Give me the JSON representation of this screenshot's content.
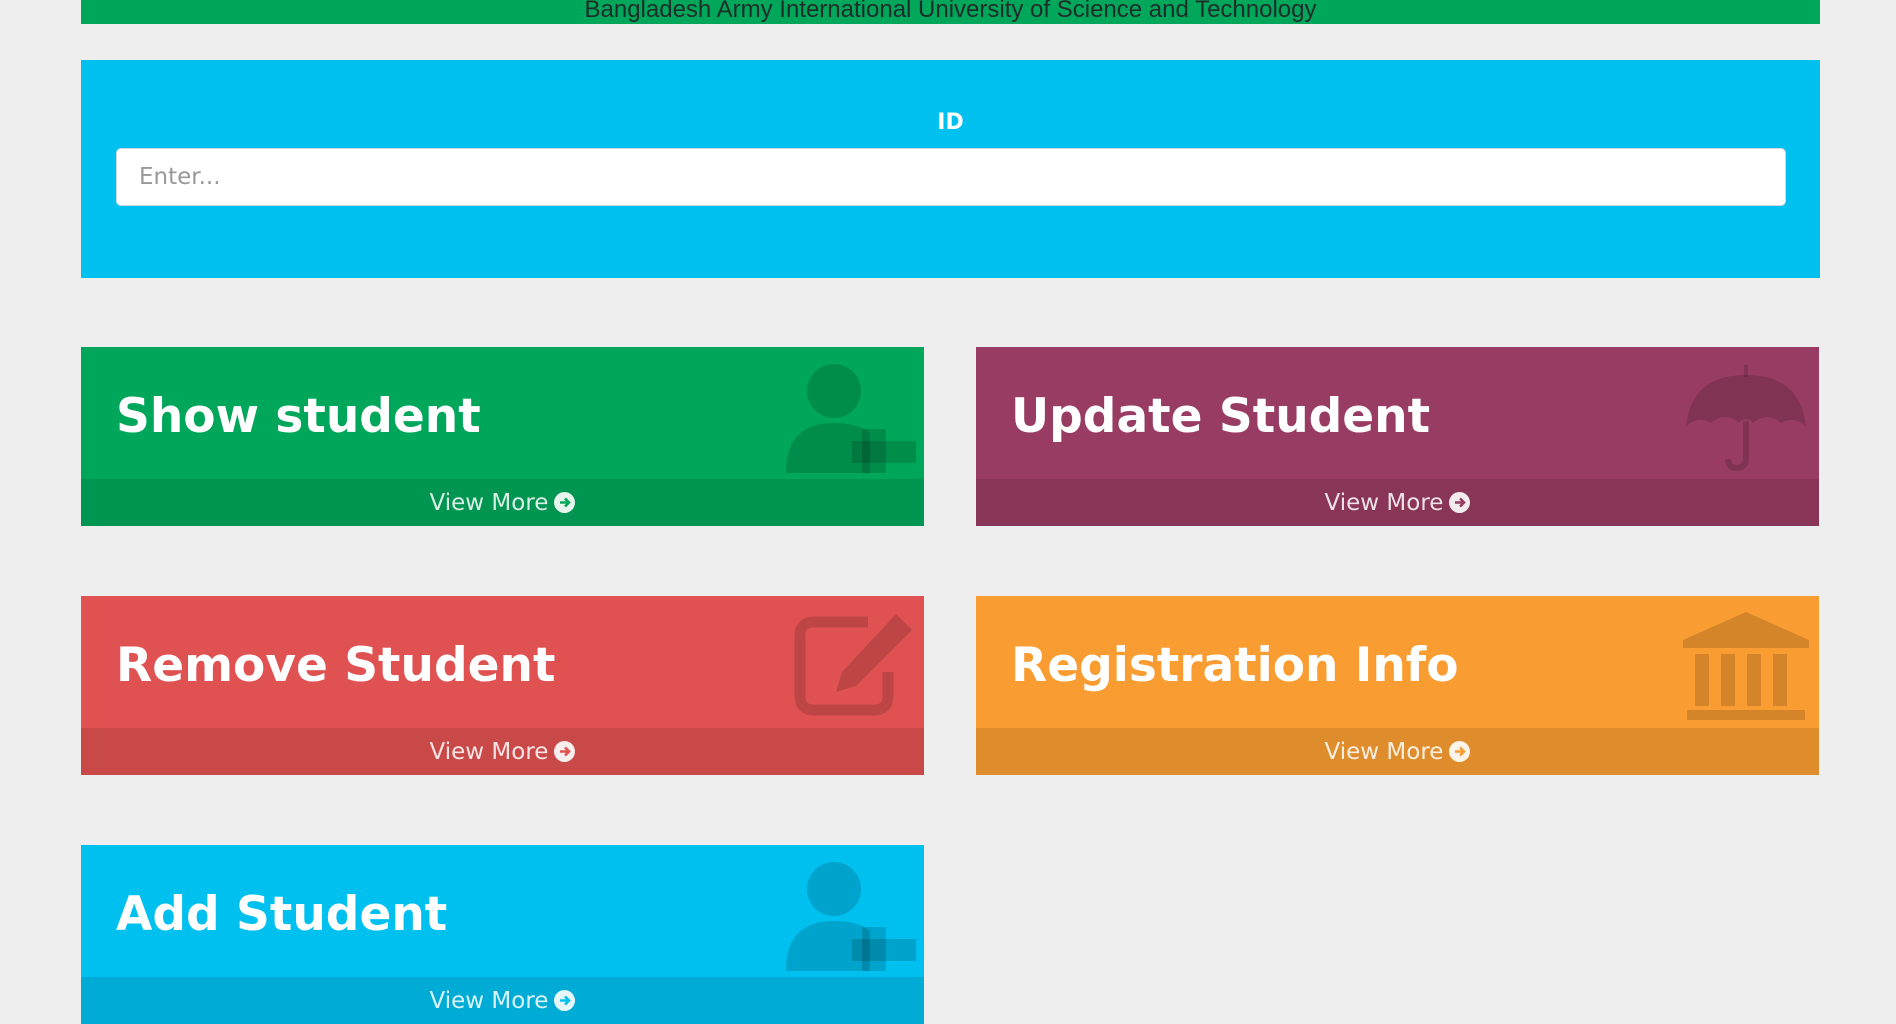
{
  "header": {
    "university_name": "Bangladesh Army International University of Science and Technology"
  },
  "search": {
    "label": "ID",
    "placeholder": "Enter..."
  },
  "boxes": [
    {
      "title": "Show student",
      "link": "View More",
      "color": "#00a65a",
      "icon": "user-plus-icon"
    },
    {
      "title": "Update Student",
      "link": "View More",
      "color": "#983c63",
      "icon": "umbrella-icon"
    },
    {
      "title": "Remove Student",
      "link": "View More",
      "color": "#e05252",
      "icon": "edit-icon"
    },
    {
      "title": "Registration Info",
      "link": "View More",
      "color": "#f99d32",
      "icon": "bank-icon"
    },
    {
      "title": "Add Student",
      "link": "View More",
      "color": "#00c0ef",
      "icon": "user-plus-icon"
    }
  ]
}
